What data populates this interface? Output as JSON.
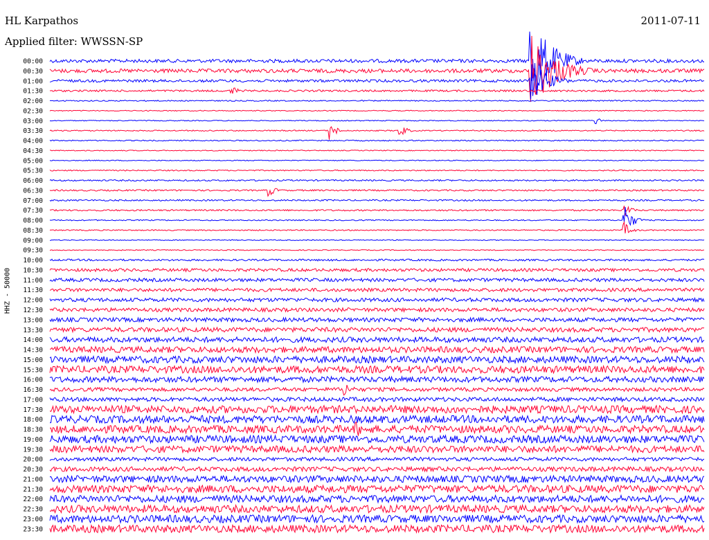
{
  "header": {
    "station": "HL Karpathos",
    "filter": "Applied filter: WWSSN-SP",
    "date": "2011-07-11",
    "channel_label": "HHZ - 50000"
  },
  "chart_data": {
    "type": "line",
    "title": "HL Karpathos",
    "subtitle": "Applied filter: WWSSN-SP",
    "date": "2011-07-11",
    "ylabel": "HHZ - 50000",
    "grid": false,
    "colors": [
      "#0000ff",
      "#ff0033"
    ],
    "row_labels": [
      "00:00",
      "00:30",
      "01:00",
      "01:30",
      "02:00",
      "02:30",
      "03:00",
      "03:30",
      "04:00",
      "04:30",
      "05:00",
      "05:30",
      "06:00",
      "06:30",
      "07:00",
      "07:30",
      "08:00",
      "08:30",
      "09:00",
      "09:30",
      "10:00",
      "10:30",
      "11:00",
      "11:30",
      "12:00",
      "12:30",
      "13:00",
      "13:30",
      "14:00",
      "14:30",
      "15:00",
      "15:30",
      "16:00",
      "16:30",
      "17:00",
      "17:30",
      "18:00",
      "18:30",
      "19:00",
      "19:30",
      "20:00",
      "20:30",
      "21:00",
      "21:30",
      "22:00",
      "22:30",
      "23:00",
      "23:30"
    ],
    "noise_level": [
      0.45,
      0.5,
      0.35,
      0.25,
      0.15,
      0.12,
      0.12,
      0.15,
      0.15,
      0.12,
      0.12,
      0.15,
      0.2,
      0.2,
      0.2,
      0.2,
      0.15,
      0.15,
      0.12,
      0.12,
      0.25,
      0.4,
      0.45,
      0.45,
      0.5,
      0.5,
      0.55,
      0.6,
      0.7,
      0.8,
      0.9,
      0.95,
      0.75,
      0.5,
      0.55,
      1.0,
      1.0,
      1.0,
      1.0,
      0.9,
      0.5,
      0.6,
      0.9,
      1.0,
      0.95,
      1.0,
      1.0,
      1.0
    ],
    "events": [
      {
        "row": 0,
        "minute": 22.0,
        "amp": 12,
        "dur": 2.5
      },
      {
        "row": 1,
        "minute": 22.0,
        "amp": 10,
        "dur": 3
      },
      {
        "row": 2,
        "minute": 22.0,
        "amp": 6,
        "dur": 2
      },
      {
        "row": 3,
        "minute": 8.3,
        "amp": 1.5,
        "dur": 0.8
      },
      {
        "row": 7,
        "minute": 12.8,
        "amp": 2.5,
        "dur": 0.8
      },
      {
        "row": 7,
        "minute": 16.0,
        "amp": 2,
        "dur": 0.8
      },
      {
        "row": 6,
        "minute": 25.0,
        "amp": 1.2,
        "dur": 0.5
      },
      {
        "row": 13,
        "minute": 10.0,
        "amp": 1.8,
        "dur": 0.8
      },
      {
        "row": 16,
        "minute": 26.3,
        "amp": 4,
        "dur": 1.0
      },
      {
        "row": 15,
        "minute": 26.3,
        "amp": 2,
        "dur": 0.8
      },
      {
        "row": 17,
        "minute": 26.3,
        "amp": 2,
        "dur": 0.8
      },
      {
        "row": 37,
        "minute": 14.0,
        "amp": 2.5,
        "dur": 1.0
      },
      {
        "row": 33,
        "minute": 13.5,
        "amp": 2,
        "dur": 1.0
      }
    ]
  }
}
